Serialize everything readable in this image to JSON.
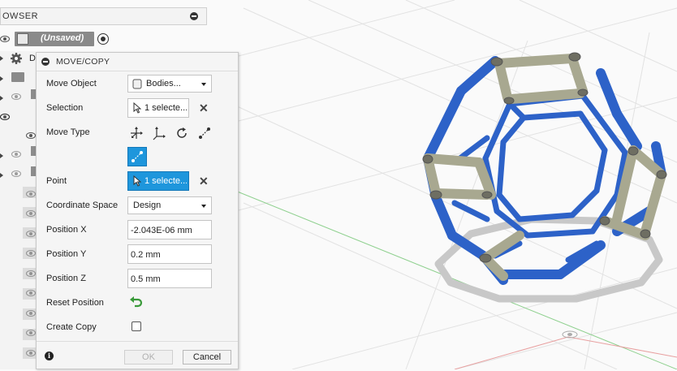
{
  "browser": {
    "title": "OWSER",
    "root_label": "(Unsaved)",
    "tree_fragment_label": "D"
  },
  "dialog": {
    "title": "MOVE/COPY",
    "move_object": {
      "label": "Move Object",
      "value": "Bodies..."
    },
    "selection": {
      "label": "Selection",
      "value": "1 selecte..."
    },
    "move_type": {
      "label": "Move Type"
    },
    "point": {
      "label": "Point",
      "value": "1 selecte..."
    },
    "coordinate_space": {
      "label": "Coordinate Space",
      "value": "Design"
    },
    "position_x": {
      "label": "Position X",
      "value": "-2.043E-06 mm"
    },
    "position_y": {
      "label": "Position Y",
      "value": "0.2 mm"
    },
    "position_z": {
      "label": "Position Z",
      "value": "0.5 mm"
    },
    "reset_position": {
      "label": "Reset Position"
    },
    "create_copy": {
      "label": "Create Copy",
      "checked": false
    },
    "ok_label": "OK",
    "cancel_label": "Cancel",
    "clear_symbol": "✕",
    "info_symbol": "i"
  },
  "colors": {
    "accent": "#1e96dc",
    "body_blue": "#2d62c8",
    "selected_gray": "#a8a890",
    "ground_shadow": "#c8c8c8"
  }
}
